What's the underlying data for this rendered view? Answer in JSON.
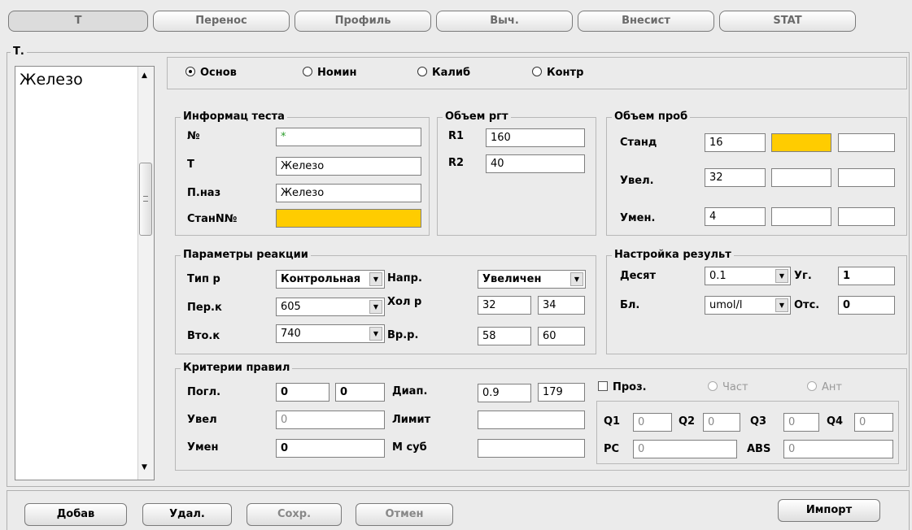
{
  "tabs": [
    "Т",
    "Перенос",
    "Профиль",
    "Выч.",
    "Внесист",
    "STAT"
  ],
  "test_list": {
    "label": "Т.",
    "items": [
      "Железо"
    ]
  },
  "mode_radios": {
    "options": [
      "Основ",
      "Номин",
      "Калиб",
      "Контр"
    ],
    "selected": "Основ"
  },
  "test_info": {
    "legend": "Информац теста",
    "no_label": "№",
    "no_value": "*",
    "name_label": "Т",
    "name_value": "Железо",
    "print_name_label": "П.наз",
    "print_name_value": "Железо",
    "std_no_label": "СтанN№",
    "std_no_value": ""
  },
  "reagent_volume": {
    "legend": "Объем ргт",
    "r1_label": "R1",
    "r1_value": "160",
    "r2_label": "R2",
    "r2_value": "40"
  },
  "sample_volume": {
    "legend": "Объем проб",
    "rows": [
      {
        "label": "Станд",
        "v1": "16",
        "v2": "",
        "v3": ""
      },
      {
        "label": "Увел.",
        "v1": "32",
        "v2": "",
        "v3": ""
      },
      {
        "label": "Умен.",
        "v1": "4",
        "v2": "",
        "v3": ""
      }
    ]
  },
  "reaction_params": {
    "legend": "Параметры реакции",
    "type_label": "Тип р",
    "type_value": "Контрольная",
    "direction_label": "Напр.",
    "direction_value": "Увеличен",
    "primary_label": "Пер.к",
    "primary_value": "605",
    "cold_label": "Хол р",
    "cold_v1": "32",
    "cold_v2": "34",
    "secondary_label": "Вто.к",
    "secondary_value": "740",
    "time_label": "Вр.р.",
    "time_v1": "58",
    "time_v2": "60"
  },
  "result_settings": {
    "legend": "Настройка результ",
    "decimal_label": "Десят",
    "decimal_value": "0.1",
    "angle_label": "Уг.",
    "angle_value": "1",
    "unit_label": "Бл.",
    "unit_value": "umol/l",
    "offset_label": "Отс.",
    "offset_value": "0"
  },
  "rule_criteria": {
    "legend": "Критерии правил",
    "abs_label": "Погл.",
    "abs_v1": "0",
    "abs_v2": "0",
    "range_label": "Диап.",
    "range_v1": "0.9",
    "range_v2": "179",
    "increase_label": "Увел",
    "increase_value": "0",
    "limit_label": "Лимит",
    "limit_value": "",
    "decrease_label": "Умен",
    "decrease_value": "0",
    "substrate_label": "М суб",
    "substrate_value": "",
    "transparency_label": "Проз.",
    "partial_label": "Част",
    "anti_label": "Ант",
    "q1_label": "Q1",
    "q1_value": "0",
    "q2_label": "Q2",
    "q2_value": "0",
    "q3_label": "Q3",
    "q3_value": "0",
    "q4_label": "Q4",
    "q4_value": "0",
    "pc_label": "PC",
    "pc_value": "0",
    "abs2_label": "ABS",
    "abs2_value": "0"
  },
  "buttons": {
    "add": "Добав",
    "delete": "Удал.",
    "save": "Сохр.",
    "cancel": "Отмен",
    "import": "Импорт"
  },
  "colors": {
    "highlight": "#ffcc00",
    "background": "#ebebeb"
  }
}
